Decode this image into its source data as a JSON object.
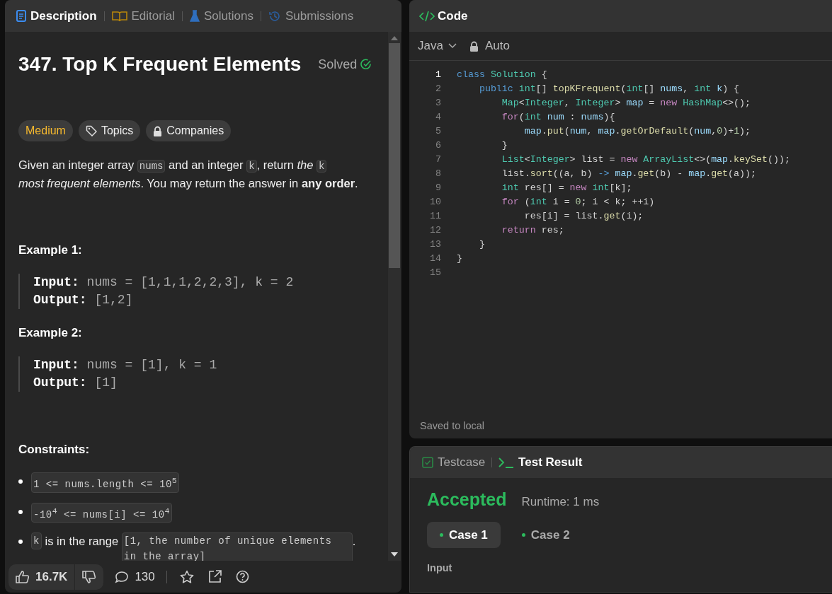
{
  "problem_panel": {
    "tabs": [
      {
        "label": "Description",
        "selected": true
      },
      {
        "label": "Editorial",
        "selected": false
      },
      {
        "label": "Solutions",
        "selected": false
      },
      {
        "label": "Submissions",
        "selected": false
      }
    ],
    "title": "347. Top K Frequent Elements",
    "status": "Solved",
    "tags": [
      {
        "label": "Medium",
        "kind": "difficulty"
      },
      {
        "label": "Topics",
        "kind": "topics"
      },
      {
        "label": "Companies",
        "kind": "companies"
      }
    ],
    "description": [
      [
        {
          "kind": "text",
          "text": "Given an integer array "
        },
        {
          "kind": "code",
          "text": "nums"
        },
        {
          "kind": "text",
          "text": " and an integer "
        },
        {
          "kind": "code",
          "text": "k"
        },
        {
          "kind": "text",
          "text": ", return *the* "
        },
        {
          "kind": "code",
          "text": "k"
        }
      ],
      [
        {
          "kind": "text",
          "text": "*most frequent elements*. You may return the answer in **any order**."
        }
      ]
    ],
    "examples": [
      {
        "heading": "Example 1:",
        "lines": [
          "**Input:** nums = [1,1,1,2,2,3], k = 2",
          "**Output:** [1,2]"
        ]
      },
      {
        "heading": "Example 2:",
        "lines": [
          "**Input:** nums = [1], k = 1",
          "**Output:** [1]"
        ]
      }
    ],
    "constraints_heading": "Constraints:",
    "constraints": [
      [
        {
          "kind": "code",
          "text": "1 <= nums.length <= 10$^{5}$"
        }
      ],
      [
        {
          "kind": "code",
          "text": "-10$^{4}$ <= nums[i] <= 10$^{4}$"
        }
      ],
      [
        {
          "kind": "code",
          "text": "k"
        },
        {
          "kind": "text",
          "text": " is in the range "
        },
        {
          "kind": "code",
          "text": "[1, the number of unique elements in the array]"
        },
        {
          "kind": "text",
          "text": "."
        }
      ]
    ],
    "footer": {
      "likes": "16.7K",
      "comments": "130"
    }
  },
  "code_panel": {
    "title": "Code",
    "language": "Java",
    "mode": "Auto",
    "lines": [
      {
        "number": "1",
        "active": true,
        "code": [
          {
            "text": "class",
            "kind": "keyword"
          },
          {
            "text": " Solution",
            "kind": "type"
          },
          {
            "text": " {",
            "kind": "plain"
          }
        ]
      },
      {
        "number": "2",
        "active": false,
        "code": [
          {
            "text": "    public",
            "kind": "keyword"
          },
          {
            "text": " int",
            "kind": "type"
          },
          {
            "text": "[] ",
            "kind": "plain"
          },
          {
            "text": "topKFrequent",
            "kind": "function"
          },
          {
            "text": "(",
            "kind": "plain"
          },
          {
            "text": "int",
            "kind": "type"
          },
          {
            "text": "[] ",
            "kind": "plain"
          },
          {
            "text": "nums",
            "kind": "variable"
          },
          {
            "text": ", ",
            "kind": "plain"
          },
          {
            "text": "int",
            "kind": "type"
          },
          {
            "text": " k",
            "kind": "variable"
          },
          {
            "text": ") {",
            "kind": "plain"
          }
        ]
      },
      {
        "number": "3",
        "active": false,
        "code": [
          {
            "text": "        Map",
            "kind": "type"
          },
          {
            "text": "<",
            "kind": "plain"
          },
          {
            "text": "Integer",
            "kind": "type"
          },
          {
            "text": ", ",
            "kind": "plain"
          },
          {
            "text": "Integer",
            "kind": "type"
          },
          {
            "text": "> ",
            "kind": "plain"
          },
          {
            "text": "map",
            "kind": "variable"
          },
          {
            "text": " = ",
            "kind": "plain"
          },
          {
            "text": "new",
            "kind": "control"
          },
          {
            "text": " HashMap",
            "kind": "type"
          },
          {
            "text": "<>();",
            "kind": "plain"
          }
        ]
      },
      {
        "number": "4",
        "active": false,
        "code": [
          {
            "text": "        for",
            "kind": "control"
          },
          {
            "text": "(",
            "kind": "plain"
          },
          {
            "text": "int",
            "kind": "type"
          },
          {
            "text": " num",
            "kind": "variable"
          },
          {
            "text": " : ",
            "kind": "plain"
          },
          {
            "text": "nums",
            "kind": "variable"
          },
          {
            "text": "){",
            "kind": "plain"
          }
        ]
      },
      {
        "number": "5",
        "active": false,
        "code": [
          {
            "text": "            map",
            "kind": "variable"
          },
          {
            "text": ".",
            "kind": "plain"
          },
          {
            "text": "put",
            "kind": "function"
          },
          {
            "text": "(",
            "kind": "plain"
          },
          {
            "text": "num",
            "kind": "variable"
          },
          {
            "text": ", ",
            "kind": "plain"
          },
          {
            "text": "map",
            "kind": "variable"
          },
          {
            "text": ".",
            "kind": "plain"
          },
          {
            "text": "getOrDefault",
            "kind": "function"
          },
          {
            "text": "(",
            "kind": "plain"
          },
          {
            "text": "num",
            "kind": "variable"
          },
          {
            "text": ",",
            "kind": "plain"
          },
          {
            "text": "0",
            "kind": "number"
          },
          {
            "text": ")+",
            "kind": "plain"
          },
          {
            "text": "1",
            "kind": "number"
          },
          {
            "text": ");",
            "kind": "plain"
          }
        ]
      },
      {
        "number": "6",
        "active": false,
        "code": [
          {
            "text": "        }",
            "kind": "plain"
          }
        ]
      },
      {
        "number": "7",
        "active": false,
        "code": [
          {
            "text": "        List",
            "kind": "type"
          },
          {
            "text": "<",
            "kind": "plain"
          },
          {
            "text": "Integer",
            "kind": "type"
          },
          {
            "text": "> list = ",
            "kind": "plain"
          },
          {
            "text": "new",
            "kind": "control"
          },
          {
            "text": " ArrayList",
            "kind": "type"
          },
          {
            "text": "<>(",
            "kind": "plain"
          },
          {
            "text": "map",
            "kind": "variable"
          },
          {
            "text": ".",
            "kind": "plain"
          },
          {
            "text": "keySet",
            "kind": "function"
          },
          {
            "text": "());",
            "kind": "plain"
          }
        ]
      },
      {
        "number": "8",
        "active": false,
        "code": [
          {
            "text": "        list.",
            "kind": "plain"
          },
          {
            "text": "sort",
            "kind": "function"
          },
          {
            "text": "((a, b) ",
            "kind": "plain"
          },
          {
            "text": "->",
            "kind": "keyword"
          },
          {
            "text": " map",
            "kind": "variable"
          },
          {
            "text": ".",
            "kind": "plain"
          },
          {
            "text": "get",
            "kind": "function"
          },
          {
            "text": "(b) - ",
            "kind": "plain"
          },
          {
            "text": "map",
            "kind": "variable"
          },
          {
            "text": ".",
            "kind": "plain"
          },
          {
            "text": "get",
            "kind": "function"
          },
          {
            "text": "(a));",
            "kind": "plain"
          }
        ]
      },
      {
        "number": "9",
        "active": false,
        "code": [
          {
            "text": "        int",
            "kind": "type"
          },
          {
            "text": " res[] = ",
            "kind": "plain"
          },
          {
            "text": "new",
            "kind": "control"
          },
          {
            "text": " int",
            "kind": "type"
          },
          {
            "text": "[k];",
            "kind": "plain"
          }
        ]
      },
      {
        "number": "10",
        "active": false,
        "code": [
          {
            "text": "        for",
            "kind": "control"
          },
          {
            "text": " (",
            "kind": "plain"
          },
          {
            "text": "int",
            "kind": "type"
          },
          {
            "text": " i = ",
            "kind": "plain"
          },
          {
            "text": "0",
            "kind": "number"
          },
          {
            "text": "; i < k; ++i)",
            "kind": "plain"
          }
        ]
      },
      {
        "number": "11",
        "active": false,
        "code": [
          {
            "text": "            res[i] = list.",
            "kind": "plain"
          },
          {
            "text": "get",
            "kind": "function"
          },
          {
            "text": "(i);",
            "kind": "plain"
          }
        ]
      },
      {
        "number": "12",
        "active": false,
        "code": [
          {
            "text": "        return",
            "kind": "control"
          },
          {
            "text": " res;",
            "kind": "plain"
          }
        ]
      },
      {
        "number": "13",
        "active": false,
        "code": [
          {
            "text": "    }",
            "kind": "plain"
          }
        ]
      },
      {
        "number": "14",
        "active": false,
        "code": [
          {
            "text": "}",
            "kind": "plain"
          }
        ]
      },
      {
        "number": "15",
        "active": false
      }
    ],
    "status": "Saved to local"
  },
  "result_panel": {
    "tabs": [
      {
        "label": "Testcase",
        "selected": false
      },
      {
        "label": "Test Result",
        "selected": true
      }
    ],
    "verdict": "Accepted",
    "runtime": "Runtime: 1 ms",
    "cases": [
      {
        "label": "Case 1",
        "selected": true
      },
      {
        "label": "Case 2",
        "selected": false
      }
    ],
    "input_label": "Input"
  }
}
